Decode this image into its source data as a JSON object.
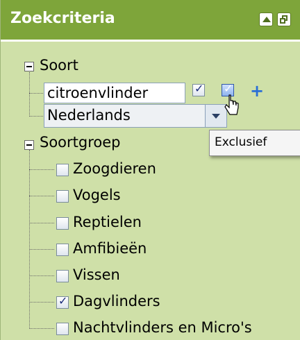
{
  "header": {
    "title": "Zoekcriteria",
    "collapse_icon": "collapse-up-icon",
    "restore_icon": "restore-window-icon",
    "color": "#7ea53a"
  },
  "soort": {
    "label": "Soort",
    "search_value": "citroenvlinder",
    "language_value": "Nederlands",
    "add_icon": "+",
    "tooltip": "Exclusief"
  },
  "soortgroep": {
    "label": "Soortgroep",
    "items": [
      {
        "label": "Zoogdieren",
        "checked": false
      },
      {
        "label": "Vogels",
        "checked": false
      },
      {
        "label": "Reptielen",
        "checked": false
      },
      {
        "label": "Amfibieën",
        "checked": false
      },
      {
        "label": "Vissen",
        "checked": false
      },
      {
        "label": "Dagvlinders",
        "checked": true
      },
      {
        "label": "Nachtvlinders en Micro's",
        "checked": false
      }
    ]
  },
  "colors": {
    "panel_bg": "#cfe0a8",
    "header_bg": "#7ea53a",
    "tick": "#1b2b79"
  }
}
